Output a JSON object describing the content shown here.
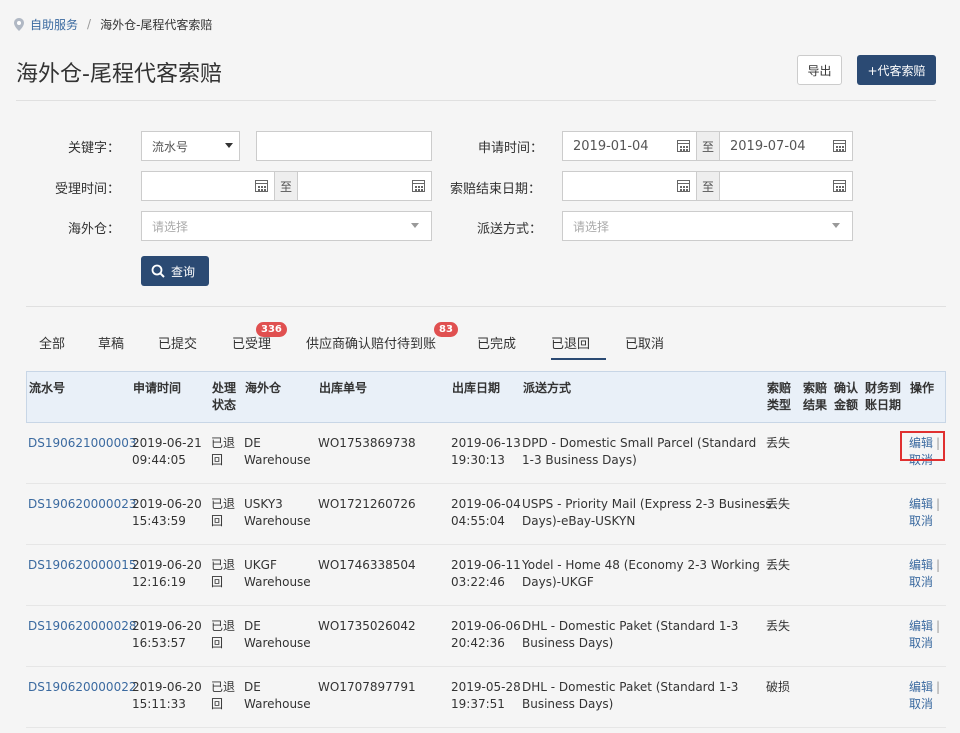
{
  "breadcrumb": {
    "home": "自助服务",
    "separator": "/",
    "current": "海外仓-尾程代客索赔"
  },
  "page_title": "海外仓-尾程代客索赔",
  "header_buttons": {
    "export": "导出",
    "add_claim": "+代客索赔"
  },
  "filters": {
    "keyword_label": "关键字：",
    "keyword_type": "流水号",
    "keyword_value": "",
    "apply_time_label": "申请时间：",
    "apply_time_start": "2019-01-04",
    "apply_time_end": "2019-07-04",
    "range_sep": "至",
    "accept_time_label": "受理时间：",
    "accept_time_start": "",
    "accept_time_end": "",
    "claim_end_label": "索赔结束日期：",
    "claim_end_start": "",
    "claim_end_end": "",
    "warehouse_label": "海外仓：",
    "warehouse_placeholder": "请选择",
    "delivery_label": "派送方式：",
    "delivery_placeholder": "请选择",
    "search_button": "查询"
  },
  "tabs": [
    {
      "label": "全部"
    },
    {
      "label": "草稿"
    },
    {
      "label": "已提交"
    },
    {
      "label": "已受理",
      "badge": "336"
    },
    {
      "label": "供应商确认赔付待到账",
      "badge": "83"
    },
    {
      "label": "已完成"
    },
    {
      "label": "已退回",
      "active": true
    },
    {
      "label": "已取消"
    }
  ],
  "table": {
    "headers": {
      "serial": "流水号",
      "apply_time": "申请时间",
      "status_1": "处理",
      "status_2": "状态",
      "warehouse": "海外仓",
      "outbound_no": "出库单号",
      "outbound_date": "出库日期",
      "delivery": "派送方式",
      "claim_type_1": "索赔",
      "claim_type_2": "类型",
      "claim_result_1": "索赔",
      "claim_result_2": "结果",
      "confirm_amount_1": "确认",
      "confirm_amount_2": "金额",
      "finance_1": "财务到",
      "finance_2": "账日期",
      "action": "操作"
    },
    "rows": [
      {
        "serial": "DS190621000003",
        "date": "2019-06-21",
        "time": "09:44:05",
        "status_1": "已退",
        "status_2": "回",
        "wh_1": "DE",
        "wh_2": "Warehouse",
        "outbound_no": "WO1753869738",
        "out_date": "2019-06-13",
        "out_time": "19:30:13",
        "delivery_1": "DPD - Domestic Small Parcel (Standard",
        "delivery_2": "1-3 Business Days)",
        "claim_type": "丢失",
        "edit": "编辑",
        "edit_sep": "|",
        "cancel": "取消"
      },
      {
        "serial": "DS190620000023",
        "date": "2019-06-20",
        "time": "15:43:59",
        "status_1": "已退",
        "status_2": "回",
        "wh_1": "USKY3",
        "wh_2": "Warehouse",
        "outbound_no": "WO1721260726",
        "out_date": "2019-06-04",
        "out_time": "04:55:04",
        "delivery_1": "USPS - Priority Mail (Express 2-3 Business",
        "delivery_2": "Days)-eBay-USKYN",
        "claim_type": "丢失",
        "edit": "编辑",
        "edit_sep": "|",
        "cancel": "取消"
      },
      {
        "serial": "DS190620000015",
        "date": "2019-06-20",
        "time": "12:16:19",
        "status_1": "已退",
        "status_2": "回",
        "wh_1": "UKGF",
        "wh_2": "Warehouse",
        "outbound_no": "WO1746338504",
        "out_date": "2019-06-11",
        "out_time": "03:22:46",
        "delivery_1": "Yodel - Home 48 (Economy 2-3 Working",
        "delivery_2": "Days)-UKGF",
        "claim_type": "丢失",
        "edit": "编辑",
        "edit_sep": "|",
        "cancel": "取消"
      },
      {
        "serial": "DS190620000028",
        "date": "2019-06-20",
        "time": "16:53:57",
        "status_1": "已退",
        "status_2": "回",
        "wh_1": "DE",
        "wh_2": "Warehouse",
        "outbound_no": "WO1735026042",
        "out_date": "2019-06-06",
        "out_time": "20:42:36",
        "delivery_1": "DHL - Domestic Paket (Standard 1-3",
        "delivery_2": "Business Days)",
        "claim_type": "丢失",
        "edit": "编辑",
        "edit_sep": "|",
        "cancel": "取消"
      },
      {
        "serial": "DS190620000022",
        "date": "2019-06-20",
        "time": "15:11:33",
        "status_1": "已退",
        "status_2": "回",
        "wh_1": "DE",
        "wh_2": "Warehouse",
        "outbound_no": "WO1707897791",
        "out_date": "2019-05-28",
        "out_time": "19:37:51",
        "delivery_1": "DHL - Domestic Paket (Standard 1-3",
        "delivery_2": "Business Days)",
        "claim_type": "破损",
        "edit": "编辑",
        "edit_sep": "|",
        "cancel": "取消"
      }
    ]
  },
  "colors": {
    "primary": "#2b4a73",
    "link": "#3b6aa0",
    "badge": "#e05050",
    "highlight": "#e03030",
    "header_bg": "#e9f0f8"
  }
}
